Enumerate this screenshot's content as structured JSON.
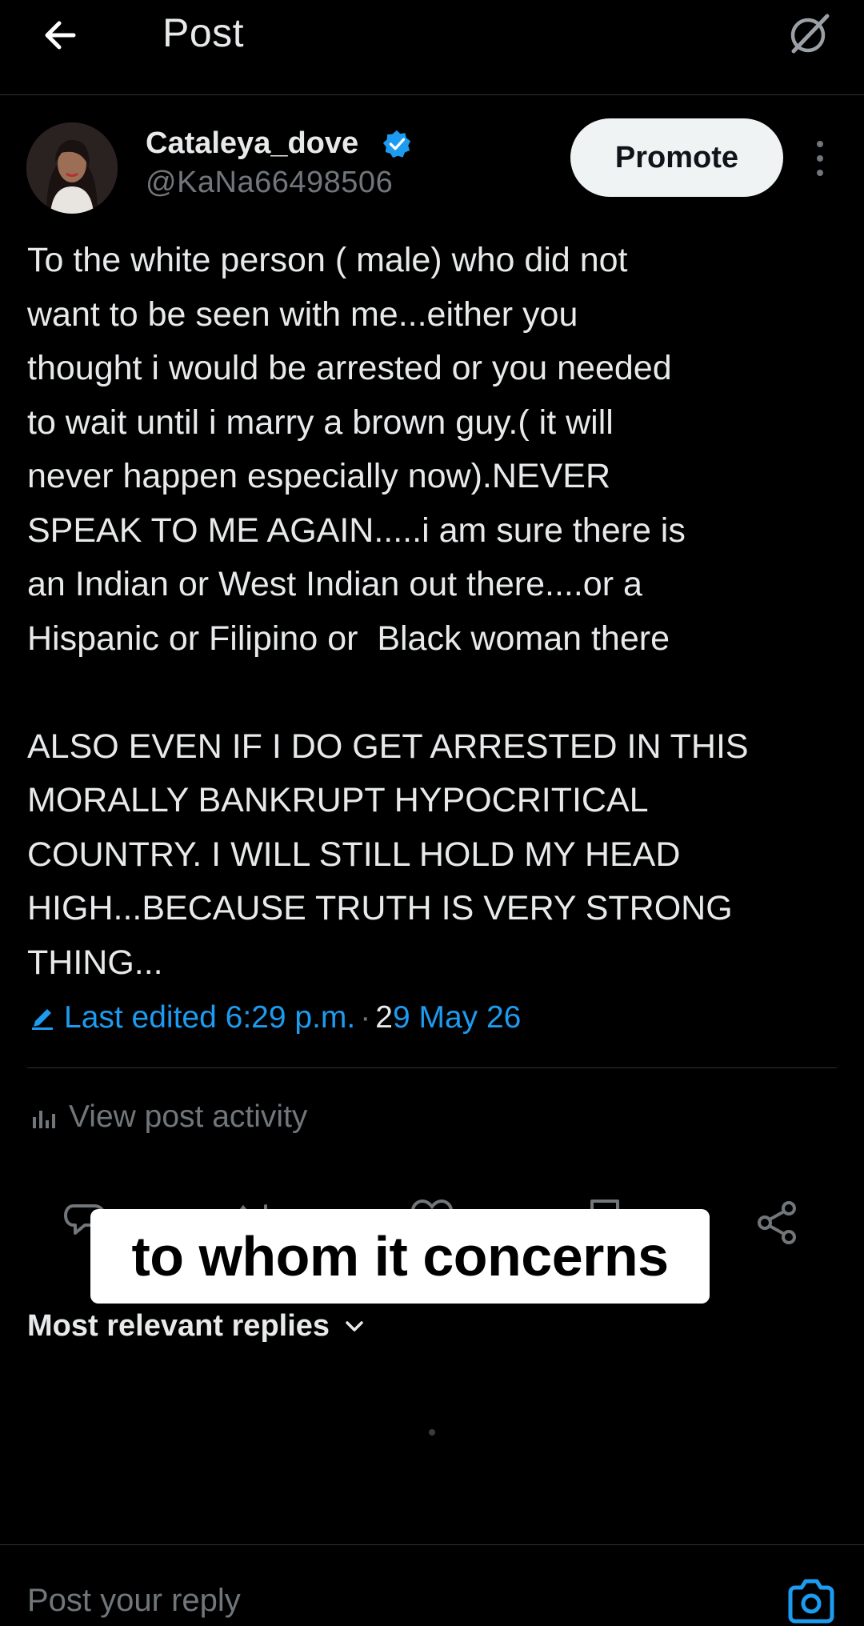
{
  "header": {
    "title": "Post",
    "back_icon": "arrow-left-icon",
    "grok_icon": "grok-icon"
  },
  "author": {
    "name": "Cataleya_dove",
    "handle": "@KaNa66498506",
    "verified_icon": "verified-badge-icon",
    "verified_color": "#1d9bf0",
    "promote_label": "Promote",
    "more_icon": "more-vertical-icon"
  },
  "post": {
    "text": "To the white person ( male) who did not\nwant to be seen with me...either you\nthought i would be arrested or you needed\nto wait until i marry a brown guy.( it will\nnever happen especially now).NEVER\nSPEAK TO ME AGAIN.....i am sure there is\nan Indian or West Indian out there....or a\nHispanic or Filipino or  Black woman there\n\nALSO EVEN IF I DO GET ARRESTED IN THIS\nMORALLY BANKRUPT HYPOCRITICAL\nCOUNTRY. I WILL STILL HOLD MY HEAD\nHIGH...BECAUSE TRUTH IS VERY STRONG\nTHING...",
    "edited_label": "Last edited 6:29 p.m.",
    "separator": "·",
    "date_prefix": "2",
    "date_rest": "9 May 26"
  },
  "activity": {
    "label": "View post activity",
    "icon": "bar-chart-icon"
  },
  "actions": {
    "icons": [
      "reply-icon",
      "repost-icon",
      "like-icon",
      "bookmark-icon",
      "share-icon"
    ]
  },
  "overlay": {
    "caption": "to whom it concerns"
  },
  "replies": {
    "sort_label": "Most relevant replies",
    "sort_icon": "chevron-down-icon"
  },
  "reply_bar": {
    "placeholder": "Post your reply",
    "camera_icon": "camera-icon"
  },
  "colors": {
    "background": "#000000",
    "accent": "#1d9bf0",
    "text_primary": "#e7e9ea",
    "text_secondary": "#71767b"
  }
}
